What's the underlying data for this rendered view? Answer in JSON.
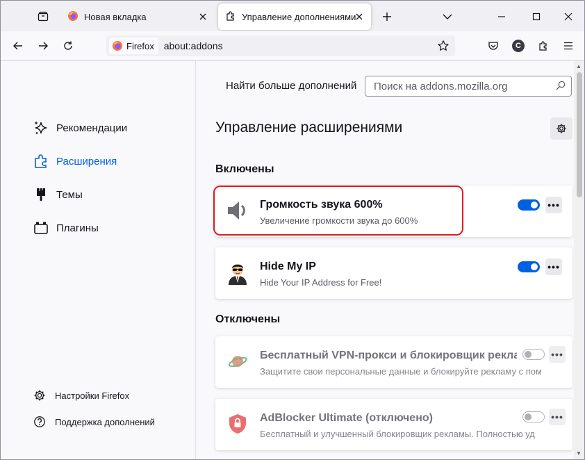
{
  "tabs": [
    {
      "label": "Новая вкладка"
    },
    {
      "label": "Управление дополнениями"
    }
  ],
  "urlbar": {
    "identity_label": "Firefox",
    "url": "about:addons"
  },
  "toolbar": {
    "account_initial": "C"
  },
  "sidebar": {
    "items": [
      {
        "label": "Рекомендации"
      },
      {
        "label": "Расширения"
      },
      {
        "label": "Темы"
      },
      {
        "label": "Плагины"
      }
    ],
    "footer": [
      {
        "label": "Настройки Firefox"
      },
      {
        "label": "Поддержка дополнений"
      }
    ]
  },
  "main": {
    "search_label": "Найти больше дополнений",
    "search_placeholder": "Поиск на addons.mozilla.org",
    "title": "Управление расширениями",
    "enabled_heading": "Включены",
    "disabled_heading": "Отключены",
    "more_label": "•••",
    "addons": [
      {
        "name": "Громкость звука 600%",
        "desc": "Увеличение громкости звука до 600%",
        "enabled": true,
        "icon": "speaker-icon"
      },
      {
        "name": "Hide My IP",
        "desc": "Hide Your IP Address for Free!",
        "enabled": true,
        "icon": "spy-avatar-icon"
      },
      {
        "name": "Бесплатный VPN-прокси и блокировщик рекла",
        "desc": "Защитите свои персональные данные и блокируйте рекламу с помо",
        "enabled": false,
        "icon": "planet-icon"
      },
      {
        "name": "AdBlocker Ultimate (отключено)",
        "desc": "Бесплатный и улучшенный блокировщик рекламы. Полностью уд",
        "enabled": false,
        "icon": "shield-lock-icon"
      }
    ]
  },
  "colors": {
    "accent": "#0061e0",
    "highlight": "#e01b24"
  }
}
